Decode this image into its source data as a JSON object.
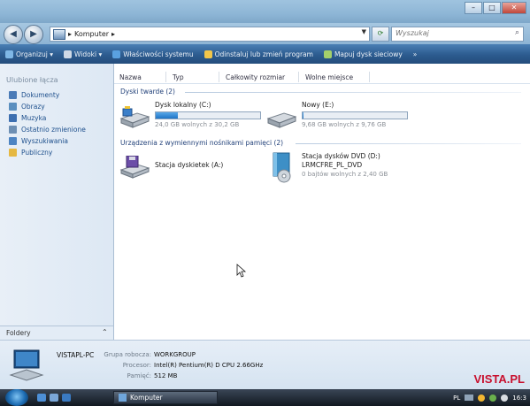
{
  "window": {
    "controls": {
      "minimize": "–",
      "maximize": "□",
      "close": "✕"
    }
  },
  "nav": {
    "back": "◀",
    "forward": "▶",
    "address": {
      "crumb": "Komputer",
      "arrow": "▸"
    },
    "search_placeholder": "Wyszukaj"
  },
  "toolbar": {
    "items": [
      {
        "label": "Organizuj ▾",
        "icon": "organize-icon",
        "color": "#7fb7e6"
      },
      {
        "label": "Widoki ▾",
        "icon": "views-icon",
        "color": "#cfd9e6"
      },
      {
        "label": "Właściwości systemu",
        "icon": "system-properties-icon",
        "color": "#5aa1e0"
      },
      {
        "label": "Odinstaluj lub zmień program",
        "icon": "uninstall-icon",
        "color": "#f2c64a"
      },
      {
        "label": "Mapuj dysk sieciowy",
        "icon": "map-drive-icon",
        "color": "#a4d06b"
      },
      {
        "label": "»",
        "icon": "more-icon",
        "color": ""
      }
    ]
  },
  "sidebar": {
    "heading": "Ulubione łącza",
    "links": [
      {
        "label": "Dokumenty",
        "icon": "documents-icon",
        "color": "#4a7bb7"
      },
      {
        "label": "Obrazy",
        "icon": "pictures-icon",
        "color": "#5a8fbf"
      },
      {
        "label": "Muzyka",
        "icon": "music-icon",
        "color": "#3d6fb0"
      },
      {
        "label": "Ostatnio zmienione",
        "icon": "recent-icon",
        "color": "#6d8fb3"
      },
      {
        "label": "Wyszukiwania",
        "icon": "searches-icon",
        "color": "#4d84c2"
      },
      {
        "label": "Publiczny",
        "icon": "public-folder-icon",
        "color": "#e5b842"
      }
    ],
    "folders_label": "Foldery",
    "folders_chevron": "⌃"
  },
  "columns": [
    "Nazwa",
    "Typ",
    "Całkowity rozmiar",
    "Wolne miejsce"
  ],
  "groups": {
    "hard_drives": "Dyski twarde (2)",
    "removable": "Urządzenia z wymiennymi nośnikami pamięci (2)"
  },
  "drives": [
    {
      "name": "Dysk lokalny (C:)",
      "free": "24,0 GB wolnych z 30,2 GB",
      "used_fraction": 0.21
    },
    {
      "name": "Nowy (E:)",
      "free": "9,68 GB wolnych z 9,76 GB",
      "used_fraction": 0.01
    }
  ],
  "removable": [
    {
      "name": "Stacja dyskietek (A:)"
    },
    {
      "name": "Stacja dysków DVD (D:)",
      "label": "LRMCFRE_PL_DVD",
      "free": "0 bajtów wolnych z 2,40 GB"
    }
  ],
  "details": {
    "pc_name": "VISTAPL-PC",
    "workgroup_label": "Grupa robocza:",
    "workgroup": "WORKGROUP",
    "processor_label": "Procesor:",
    "processor": "Intel(R) Pentium(R) D  CPU 2.66GHz",
    "memory_label": "Pamięć:",
    "memory": "512 MB",
    "logo": "VISTA.PL"
  },
  "taskbar": {
    "task_label": "Komputer",
    "lang": "PL",
    "clock": "16:3"
  }
}
